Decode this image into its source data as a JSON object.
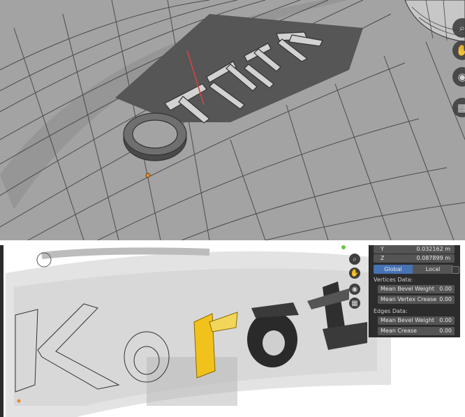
{
  "top_viewport": {
    "object_text": "OTHER"
  },
  "bottom_viewport": {
    "object_text": "Karat",
    "properties": {
      "y_label": "Y",
      "y_value": "0.032162 m",
      "z_label": "Z",
      "z_value": "0.087899 m",
      "transform_space": {
        "global": "Global",
        "local": "Local",
        "selected": "global"
      },
      "vertices_heading": "Vertices Data:",
      "vertices_rows": [
        {
          "label": "Mean Bevel Weight",
          "value": "0.00"
        },
        {
          "label": "Mean Vertex Crease",
          "value": "0.00"
        }
      ],
      "edges_heading": "Edges Data:",
      "edges_rows": [
        {
          "label": "Mean Bevel Weight",
          "value": "0.00"
        },
        {
          "label": "Mean Crease",
          "value": "0.00"
        }
      ]
    }
  },
  "colors": {
    "accent_blue": "#4772b3",
    "selection_yellow": "#f2c21c",
    "origin_orange": "#e8892b"
  },
  "icons": [
    "zoom-icon",
    "hand-pan-icon",
    "camera-icon",
    "grid-icon"
  ]
}
